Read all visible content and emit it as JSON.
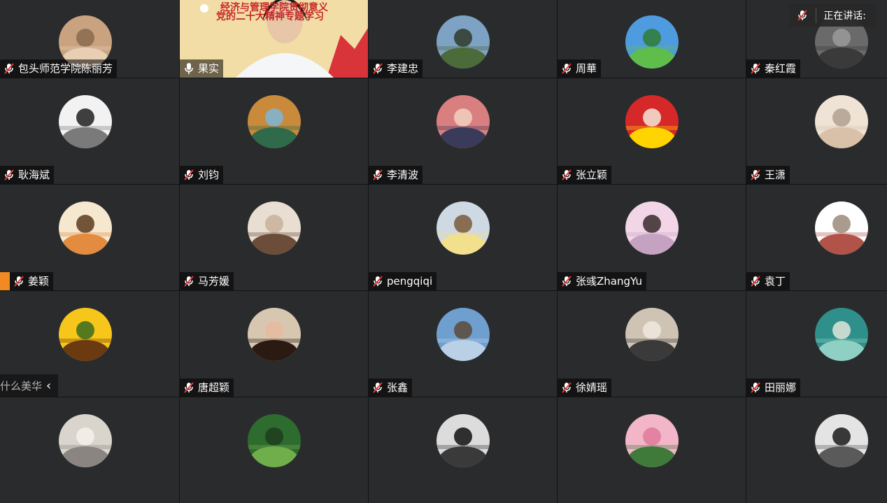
{
  "speaking_indicator": {
    "label": "正在讲话:"
  },
  "collapse_toggle": {
    "ghost_text": "什么美华",
    "chevron": "‹"
  },
  "video_banner": {
    "line1": "经济与管理学院贯彻意义",
    "line2": "党的二十大精神专题学习"
  },
  "participants": [
    {
      "name": "包头师范学院陈丽芳",
      "mic": "muted",
      "avatar": "child-portrait"
    },
    {
      "name": "果实",
      "mic": "active",
      "avatar": "video-feed"
    },
    {
      "name": "李建忠",
      "mic": "muted",
      "avatar": "windmill-landscape"
    },
    {
      "name": "周華",
      "mic": "muted",
      "avatar": "cartoon-field"
    },
    {
      "name": "秦红霞",
      "mic": "muted",
      "avatar": "dark-photo"
    },
    {
      "name": "耿海斌",
      "mic": "muted",
      "avatar": "bw-interior"
    },
    {
      "name": "刘钧",
      "mic": "muted",
      "avatar": "mountain-lake"
    },
    {
      "name": "李清波",
      "mic": "muted",
      "avatar": "family-cartoon"
    },
    {
      "name": "张立颖",
      "mic": "muted",
      "avatar": "flag-cat"
    },
    {
      "name": "王潇",
      "mic": "muted",
      "avatar": "two-babies"
    },
    {
      "name": "姜颖",
      "mic": "muted",
      "avatar": "tiger-cartoon"
    },
    {
      "name": "马芳媛",
      "mic": "muted",
      "avatar": "woman-portrait"
    },
    {
      "name": "pengqiqi",
      "mic": "muted",
      "avatar": "little-girl"
    },
    {
      "name": "张彧ZhangYu",
      "mic": "muted",
      "avatar": "woman-profile"
    },
    {
      "name": "袁丁",
      "mic": "muted",
      "avatar": "ink-painting"
    },
    {
      "name": "",
      "mic": "none",
      "avatar": "sunflower"
    },
    {
      "name": "唐超颖",
      "mic": "muted",
      "avatar": "selfie-woman"
    },
    {
      "name": "张鑫",
      "mic": "muted",
      "avatar": "village-sky"
    },
    {
      "name": "徐婧瑶",
      "mic": "muted",
      "avatar": "mother-child"
    },
    {
      "name": "田丽娜",
      "mic": "muted",
      "avatar": "teal-dandelion"
    },
    {
      "name": "",
      "mic": "none",
      "avatar": "cat-photo"
    },
    {
      "name": "",
      "mic": "none",
      "avatar": "green-plant"
    },
    {
      "name": "",
      "mic": "none",
      "avatar": "horse-bw"
    },
    {
      "name": "",
      "mic": "none",
      "avatar": "pink-flowers"
    },
    {
      "name": "",
      "mic": "none",
      "avatar": "bw-reading"
    }
  ],
  "colors": {
    "tile_bg": "#2a2b2d",
    "grid_gap": "#121315",
    "mic_muted": "#ffffff",
    "mic_slash": "#e53935",
    "orange_badge": "#f08a24"
  }
}
